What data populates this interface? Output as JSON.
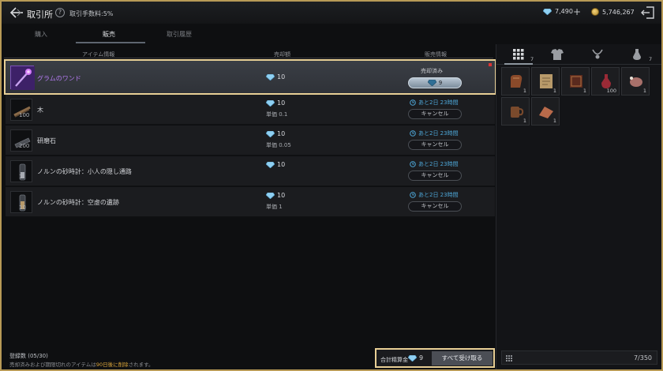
{
  "header": {
    "title": "取引所",
    "help": "?",
    "fee": "取引手数料:5%",
    "diamonds": "7,490",
    "plus": "+",
    "gold": "5,746,267"
  },
  "tabs": [
    {
      "label": "購入"
    },
    {
      "label": "販売"
    },
    {
      "label": "取引履歴"
    }
  ],
  "columns": {
    "item": "アイテム情報",
    "price": "売却額",
    "status": "販売情報"
  },
  "rows": [
    {
      "name": "グラムのワンド",
      "qty": "",
      "price": "10",
      "unit": "",
      "status": "売却済み",
      "receive": "9"
    },
    {
      "name": "木",
      "qty": "100",
      "price": "10",
      "unit": "単価 0.1",
      "timer": "あと2日 23時間",
      "cancel": "キャンセル"
    },
    {
      "name": "研磨石",
      "qty": "200",
      "price": "10",
      "unit": "単価 0.05",
      "timer": "あと2日 23時間",
      "cancel": "キャンセル"
    },
    {
      "name": "ノルンの砂時計：小人の隠し通路",
      "qty": "1",
      "price": "10",
      "unit": "",
      "timer": "あと2日 23時間",
      "cancel": "キャンセル"
    },
    {
      "name": "ノルンの砂時計：空虚の遺跡",
      "qty": "10",
      "price": "10",
      "unit": "単価 1",
      "timer": "あと2日 23時間",
      "cancel": "キャンセル"
    }
  ],
  "footer": {
    "count": "登録数 (05/30)",
    "note_prefix": "売却済みおよび期限切れのアイテムは",
    "note_highlight": "90日後に削除",
    "note_suffix": "されます。",
    "settle_label": "合計精算金",
    "settle_amount": "9",
    "receive_all": "すべて受け取る"
  },
  "inventory": {
    "tab_count_all": "7",
    "tab_count_other": "7",
    "slots": [
      {
        "count": "1",
        "icon": "gloves-icon",
        "color": "#8a4a2a"
      },
      {
        "count": "1",
        "icon": "scroll-icon",
        "color": "#b89a6a"
      },
      {
        "count": "1",
        "icon": "book-icon",
        "color": "#5a2a1e"
      },
      {
        "count": "100",
        "icon": "potion-icon",
        "color": "#9a2a36"
      },
      {
        "count": "1",
        "icon": "meat-icon",
        "color": "#a8706a"
      },
      {
        "count": "1",
        "icon": "mug-icon",
        "color": "#7a4a2c"
      },
      {
        "count": "1",
        "icon": "bread-icon",
        "color": "#b86a4a"
      }
    ],
    "capacity": "7/350"
  }
}
